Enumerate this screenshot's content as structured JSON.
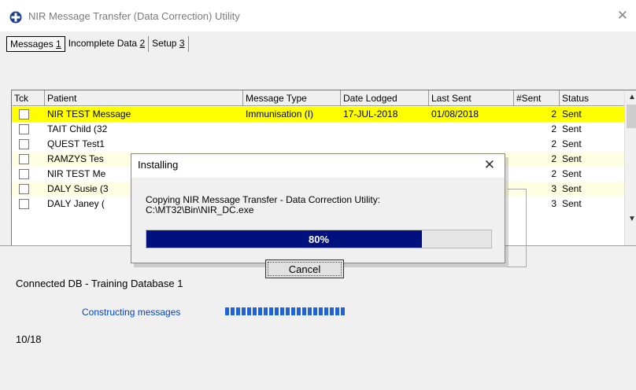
{
  "window": {
    "title": "NIR Message Transfer (Data Correction) Utility",
    "close_glyph": "✕"
  },
  "tabs": [
    {
      "label": "Messages ",
      "accel": "1"
    },
    {
      "label": "Incomplete Data ",
      "accel": "2"
    },
    {
      "label": "Setup ",
      "accel": "3"
    }
  ],
  "grid": {
    "columns": [
      "Tck",
      "Patient",
      "Message Type",
      "Date Lodged",
      "Last Sent",
      "#Sent",
      "Status"
    ],
    "rows": [
      {
        "patient": "NIR TEST Message",
        "type": "Immunisation (I)",
        "lodged": "17-JUL-2018",
        "last_sent": "01/08/2018",
        "sent": "2",
        "status": "Sent"
      },
      {
        "patient": "TAIT Child (32",
        "type": "",
        "lodged": "",
        "last_sent": "",
        "sent": "2",
        "status": "Sent"
      },
      {
        "patient": "QUEST Test1",
        "type": "",
        "lodged": "",
        "last_sent": "",
        "sent": "2",
        "status": "Sent"
      },
      {
        "patient": "RAMZYS Tes",
        "type": "",
        "lodged": "",
        "last_sent": "",
        "sent": "2",
        "status": "Sent"
      },
      {
        "patient": "NIR TEST Me",
        "type": "",
        "lodged": "",
        "last_sent": "",
        "sent": "2",
        "status": "Sent"
      },
      {
        "patient": "DALY Susie (3",
        "type": "",
        "lodged": "",
        "last_sent": "",
        "sent": "3",
        "status": "Sent"
      },
      {
        "patient": "DALY Janey (",
        "type": "",
        "lodged": "",
        "last_sent": "",
        "sent": "3",
        "status": "Sent"
      }
    ],
    "row_highlight": "#ffff00",
    "row_alt": "#fefee2"
  },
  "status": {
    "db": "Connected DB - Training Database 1",
    "constructing": "Constructing messages",
    "constructing_progress": 1.0,
    "counter": "10/18"
  },
  "dialog": {
    "title": "Installing",
    "close_glyph": "✕",
    "message_line1": "Copying NIR Message Transfer - Data Correction Utility:",
    "message_line2": "C:\\MT32\\Bin\\NIR_DC.exe",
    "progress_text": "80%",
    "progress_value": 0.8,
    "progress_color": "#00107c",
    "cancel_label": "Cancel"
  },
  "icons": {
    "app": "nir-logo-icon",
    "checkbox": "checkbox-icon",
    "scroll_up": "chevron-up-icon",
    "scroll_down": "chevron-down-icon"
  }
}
